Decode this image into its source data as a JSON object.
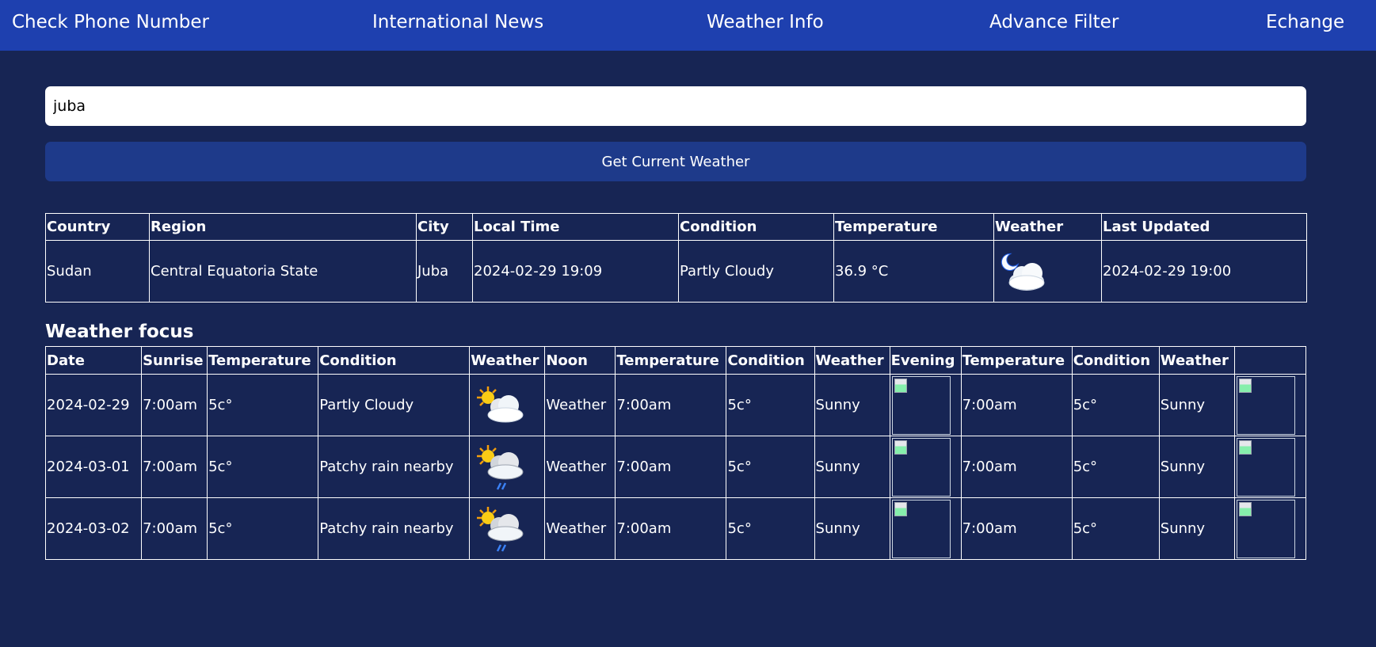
{
  "nav": {
    "items": [
      "Check Phone Number",
      "International News",
      "Weather Info",
      "Advance Filter",
      "Echange"
    ]
  },
  "search": {
    "value": "juba",
    "button_label": "Get Current Weather"
  },
  "current": {
    "headers": [
      "Country",
      "Region",
      "City",
      "Local Time",
      "Condition",
      "Temperature",
      "Weather",
      "Last Updated"
    ],
    "row": {
      "country": "Sudan",
      "region": "Central Equatoria State",
      "city": "Juba",
      "local_time": "2024-02-29 19:09",
      "condition": "Partly Cloudy",
      "temperature": "36.9 °C",
      "weather_icon": "moon-cloud-icon",
      "last_updated": "2024-02-29 19:00"
    }
  },
  "focus": {
    "title": "Weather focus",
    "headers": [
      "Date",
      "Sunrise",
      "Temperature",
      "Condition",
      "Weather",
      "Noon",
      "Temperature",
      "Condition",
      "Weather",
      "Evening",
      "Temperature",
      "Condition",
      "Weather",
      ""
    ],
    "rows": [
      {
        "date": "2024-02-29",
        "sunrise": "7:00am",
        "sunrise_temp": "5c°",
        "sunrise_condition": "Partly Cloudy",
        "sunrise_icon": "sun-cloud-icon",
        "noon": "Weather",
        "noon_time": "7:00am",
        "noon_temp": "5c°",
        "noon_condition": "Sunny",
        "evening_time": "7:00am",
        "evening_temp": "5c°",
        "evening_condition": "Sunny"
      },
      {
        "date": "2024-03-01",
        "sunrise": "7:00am",
        "sunrise_temp": "5c°",
        "sunrise_condition": "Patchy rain nearby",
        "sunrise_icon": "sun-cloud-rain-icon",
        "noon": "Weather",
        "noon_time": "7:00am",
        "noon_temp": "5c°",
        "noon_condition": "Sunny",
        "evening_time": "7:00am",
        "evening_temp": "5c°",
        "evening_condition": "Sunny"
      },
      {
        "date": "2024-03-02",
        "sunrise": "7:00am",
        "sunrise_temp": "5c°",
        "sunrise_condition": "Patchy rain nearby",
        "sunrise_icon": "sun-cloud-rain-icon",
        "noon": "Weather",
        "noon_time": "7:00am",
        "noon_temp": "5c°",
        "noon_condition": "Sunny",
        "evening_time": "7:00am",
        "evening_temp": "5c°",
        "evening_condition": "Sunny"
      }
    ]
  },
  "colors": {
    "page_bg": "#172554",
    "nav_bg": "#1e40af",
    "button_bg": "#1e3a8a",
    "border": "#ffffff"
  }
}
